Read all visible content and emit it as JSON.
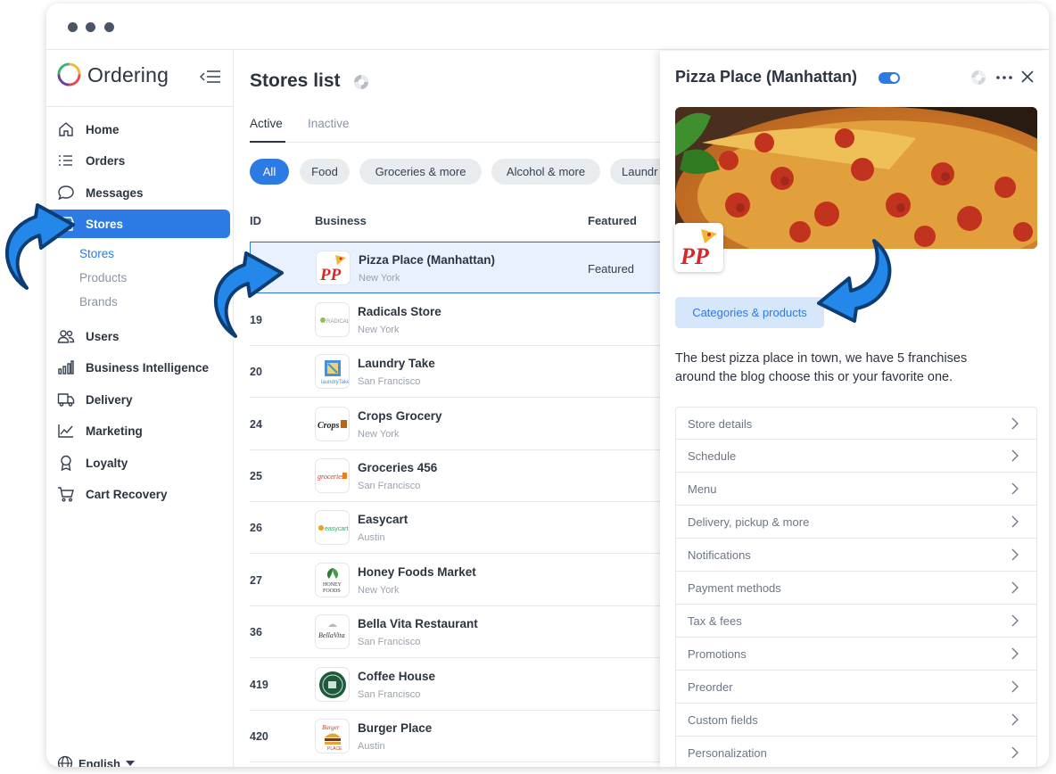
{
  "app": {
    "name": "Ordering"
  },
  "sidebar": {
    "items": [
      {
        "label": "Home",
        "icon": "home-icon"
      },
      {
        "label": "Orders",
        "icon": "list-icon"
      },
      {
        "label": "Messages",
        "icon": "chat-icon"
      },
      {
        "label": "Stores",
        "icon": "shop-icon",
        "active": true
      },
      {
        "label": "Users",
        "icon": "users-icon"
      },
      {
        "label": "Business Intelligence",
        "icon": "bar-chart-icon"
      },
      {
        "label": "Delivery",
        "icon": "truck-icon"
      },
      {
        "label": "Marketing",
        "icon": "trend-icon"
      },
      {
        "label": "Loyalty",
        "icon": "award-icon"
      },
      {
        "label": "Cart Recovery",
        "icon": "cart-icon"
      }
    ],
    "sub_items": [
      "Stores",
      "Products",
      "Brands"
    ],
    "language": "English"
  },
  "main": {
    "title": "Stores list",
    "tabs": [
      "Active",
      "Inactive"
    ],
    "chips": [
      "All",
      "Food",
      "Groceries & more",
      "Alcohol & more",
      "Laundr"
    ],
    "columns": {
      "id": "ID",
      "business": "Business",
      "featured": "Featured"
    },
    "rows": [
      {
        "id": "",
        "name": "Pizza Place (Manhattan)",
        "city": "New York",
        "featured": "Featured"
      },
      {
        "id": "19",
        "name": "Radicals Store",
        "city": "New York",
        "featured": ""
      },
      {
        "id": "20",
        "name": "Laundry Take",
        "city": "San Francisco",
        "featured": ""
      },
      {
        "id": "24",
        "name": "Crops Grocery",
        "city": "New York",
        "featured": ""
      },
      {
        "id": "25",
        "name": "Groceries 456",
        "city": "San Francisco",
        "featured": ""
      },
      {
        "id": "26",
        "name": "Easycart",
        "city": "Austin",
        "featured": ""
      },
      {
        "id": "27",
        "name": "Honey Foods Market",
        "city": "New York",
        "featured": ""
      },
      {
        "id": "36",
        "name": "Bella Vita Restaurant",
        "city": "San Francisco",
        "featured": ""
      },
      {
        "id": "419",
        "name": "Coffee House",
        "city": "San Francisco",
        "featured": ""
      },
      {
        "id": "420",
        "name": "Burger Place",
        "city": "Austin",
        "featured": ""
      }
    ]
  },
  "panel": {
    "title": "Pizza Place (Manhattan)",
    "logo_text": "PP",
    "categories_button": "Categories & products",
    "description": "The best pizza place in town, we have 5 franchises around the blog choose this or your favorite one.",
    "menu": [
      "Store details",
      "Schedule",
      "Menu",
      "Delivery, pickup & more",
      "Notifications",
      "Payment methods",
      "Tax & fees",
      "Promotions",
      "Preorder",
      "Custom fields",
      "Personalization"
    ]
  },
  "colors": {
    "accent": "#2c7be5",
    "text": "#2c3440",
    "muted": "#8a94a3",
    "selected_row": "#e8f1fd"
  }
}
